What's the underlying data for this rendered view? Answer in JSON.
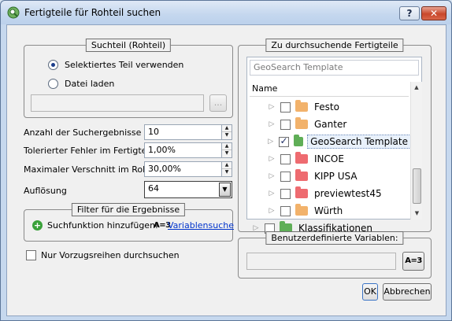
{
  "window": {
    "title": "Fertigteile für Rohteil suchen",
    "help_label": "?",
    "close_label": "✕"
  },
  "search_part": {
    "title": "Suchteil (Rohteil)",
    "radio_selected_part": "Selektiertes Teil verwenden",
    "radio_load_file": "Datei laden",
    "file_path_value": "",
    "browse_label": "..."
  },
  "fields": {
    "result_count_label": "Anzahl der Suchergebnisse",
    "result_count_value": "10",
    "tolerance_label": "Tolerierter Fehler im Fertigteil",
    "tolerance_value": "1,00%",
    "waste_label": "Maximaler Verschnitt im Rohteil",
    "waste_value": "30,00%",
    "resolution_label": "Auflösung",
    "resolution_value": "64"
  },
  "filter": {
    "title": "Filter für die Ergebnisse",
    "add_function_label": "Suchfunktion hinzufügen:",
    "var_icon_text": "A=3",
    "variable_search_link": "Variablensuche"
  },
  "preferred_series_label": "Nur Vorzugsreihen durchsuchen",
  "parts_panel": {
    "title": "Zu durchsuchende Fertigteile",
    "search_placeholder": "GeoSearch Template",
    "column_header": "Name",
    "items": [
      {
        "label": "Festo",
        "checked": false,
        "color": "#f2b26b",
        "indent": 1
      },
      {
        "label": "Ganter",
        "checked": false,
        "color": "#f2b26b",
        "indent": 1
      },
      {
        "label": "GeoSearch Template",
        "checked": true,
        "color": "#5fae57",
        "indent": 1
      },
      {
        "label": "INCOE",
        "checked": false,
        "color": "#ee6b70",
        "indent": 1
      },
      {
        "label": "KIPP USA",
        "checked": false,
        "color": "#ee6b70",
        "indent": 1
      },
      {
        "label": "previewtest45",
        "checked": false,
        "color": "#ee6b70",
        "indent": 1
      },
      {
        "label": "Würth",
        "checked": false,
        "color": "#f2b26b",
        "indent": 1
      },
      {
        "label": "Klassifikationen",
        "checked": false,
        "color": "#5fae57",
        "indent": 0
      }
    ]
  },
  "custom_vars": {
    "title": "Benutzerdefinierte Variablen:",
    "input_value": "",
    "button_icon_text": "A=3"
  },
  "buttons": {
    "ok": "OK",
    "cancel": "Abbrechen"
  }
}
